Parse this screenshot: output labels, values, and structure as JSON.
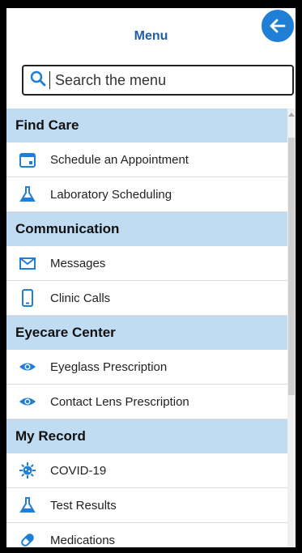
{
  "menu": {
    "title": "Menu",
    "search_placeholder": "Search the menu"
  },
  "sections": [
    {
      "title": "Find Care",
      "items": [
        {
          "label": "Schedule an Appointment",
          "icon": "calendar-icon"
        },
        {
          "label": "Laboratory Scheduling",
          "icon": "flask-icon"
        }
      ]
    },
    {
      "title": "Communication",
      "items": [
        {
          "label": "Messages",
          "icon": "envelope-icon"
        },
        {
          "label": "Clinic Calls",
          "icon": "phone-icon"
        }
      ]
    },
    {
      "title": "Eyecare Center",
      "items": [
        {
          "label": "Eyeglass Prescription",
          "icon": "eye-icon"
        },
        {
          "label": "Contact Lens Prescription",
          "icon": "eye-icon"
        }
      ]
    },
    {
      "title": "My Record",
      "items": [
        {
          "label": "COVID-19",
          "icon": "virus-icon"
        },
        {
          "label": "Test Results",
          "icon": "flask-icon"
        },
        {
          "label": "Medications",
          "icon": "pill-icon"
        }
      ]
    }
  ],
  "colors": {
    "accent": "#1f7fd6",
    "title": "#1f5fa8",
    "section_bg": "#bfdcf2"
  }
}
